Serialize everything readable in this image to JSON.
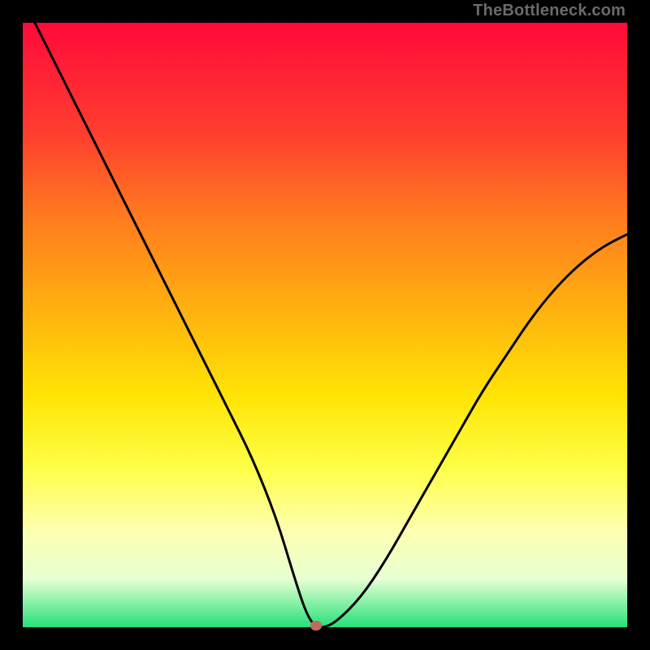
{
  "watermark": "TheBottleneck.com",
  "colors": {
    "background": "#000000",
    "curve": "#000000",
    "marker": "#c26a5d",
    "gradient_stops": [
      "#ff0a3a",
      "#ff3d2f",
      "#ff7a1f",
      "#ffb30f",
      "#ffe505",
      "#feff4a",
      "#fdffb0",
      "#e7ffd3",
      "#26e07a"
    ]
  },
  "chart_data": {
    "type": "line",
    "title": "",
    "xlabel": "",
    "ylabel": "",
    "xlim": [
      0,
      100
    ],
    "ylim": [
      0,
      100
    ],
    "marker_point": {
      "x": 48.5,
      "y": 0
    },
    "x": [
      2,
      6,
      10,
      14,
      18,
      22,
      26,
      30,
      34,
      38,
      42,
      45,
      47,
      48.5,
      50,
      52,
      56,
      60,
      64,
      68,
      72,
      76,
      80,
      84,
      88,
      92,
      96,
      100
    ],
    "values": [
      100,
      92,
      84,
      76,
      68,
      60,
      52,
      44,
      36,
      28,
      18,
      8,
      2,
      0,
      0,
      1,
      5,
      11,
      18,
      25,
      32,
      39,
      45,
      51,
      56,
      60,
      63,
      65
    ]
  }
}
